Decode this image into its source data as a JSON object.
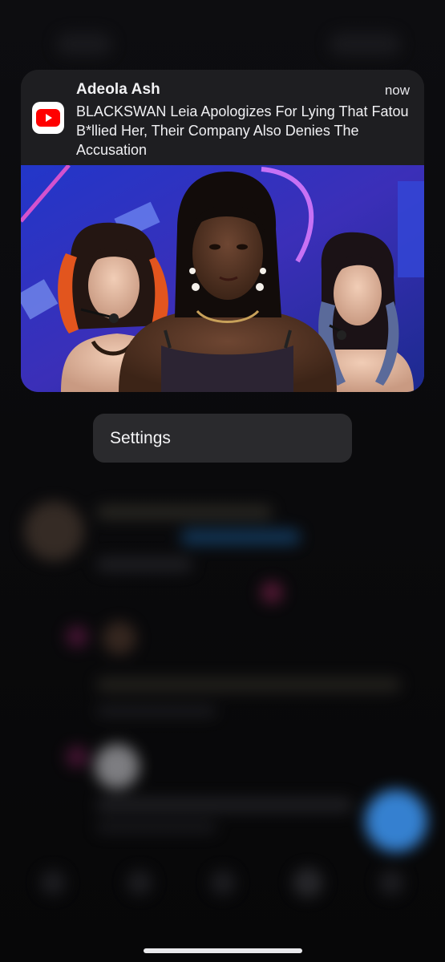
{
  "notification": {
    "app_icon": "youtube-icon",
    "sender": "Adeola Ash",
    "time": "now",
    "body": "BLACKSWAN Leia Apologizes For Lying That Fatou B*llied Her, Their Company Also Denies The Accusation",
    "thumbnail_subject": "three performers on stage with purple-blue lighting"
  },
  "context_menu": {
    "settings_label": "Settings"
  },
  "colors": {
    "background": "#0b0b0d",
    "card": "#1e1e21",
    "menu": "#2a2a2d",
    "youtube_red": "#ff0000",
    "fab_blue": "#3a8ee6"
  }
}
